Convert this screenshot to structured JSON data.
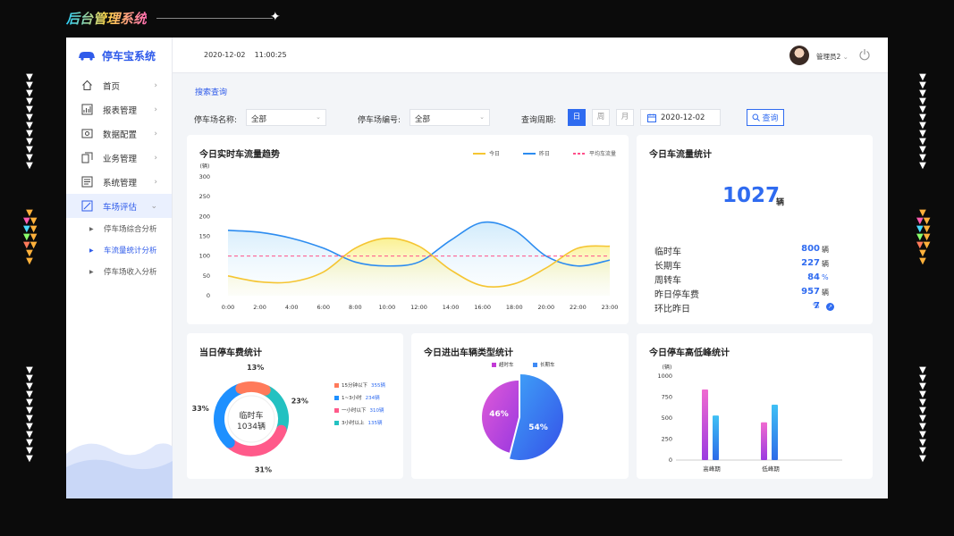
{
  "outer_title": "后台管理系统",
  "brand": "停车宝系统",
  "header": {
    "date": "2020-12-02",
    "time": "11:00:25",
    "user": "管理员2"
  },
  "nav": {
    "items": [
      {
        "label": "首页",
        "icon": "home-icon"
      },
      {
        "label": "报表管理",
        "icon": "report-icon"
      },
      {
        "label": "数据配置",
        "icon": "config-icon"
      },
      {
        "label": "业务管理",
        "icon": "business-icon"
      },
      {
        "label": "系统管理",
        "icon": "system-icon"
      },
      {
        "label": "车场评估",
        "icon": "evaluate-icon"
      }
    ],
    "sub_items": [
      "停车场综合分析",
      "车流量统计分析",
      "停车场收入分析"
    ]
  },
  "filters": {
    "section": "搜索查询",
    "name_label": "停车场名称:",
    "name_value": "全部",
    "code_label": "停车场编号:",
    "code_value": "全部",
    "period_label": "查询周期:",
    "periods": [
      "日",
      "周",
      "月"
    ],
    "date": "2020-12-02",
    "query_button": "查询"
  },
  "trend": {
    "title": "今日实时车流量趋势",
    "unit": "(辆)",
    "legend": [
      "今日",
      "昨日",
      "平均车流量"
    ],
    "colors": {
      "today": "#f5c532",
      "yesterday": "#2c8cf0",
      "average": "#ff4f8a"
    }
  },
  "stats": {
    "title": "今日车流量统计",
    "total": "1027",
    "total_unit": "辆",
    "rows": [
      {
        "label": "临时车",
        "value": "800",
        "unit": "辆"
      },
      {
        "label": "长期车",
        "value": "227",
        "unit": "辆"
      },
      {
        "label": "周转车",
        "value": "84",
        "unit": "%"
      },
      {
        "label": "昨日停车费",
        "value": "957",
        "unit": "辆"
      },
      {
        "label": "环比昨日",
        "value": "7",
        "unit": "%"
      }
    ]
  },
  "fee": {
    "title": "当日停车费统计",
    "center_label": "临时车",
    "center_value": "1034辆",
    "segments": [
      {
        "label": "15分钟以下",
        "value": "355辆",
        "pct": "23%",
        "color": "#23c1c1"
      },
      {
        "label": "1~3小时",
        "value": "234辆",
        "pct": "31%",
        "color": "#ff5a8a"
      },
      {
        "label": "一小时以下",
        "value": "310辆",
        "pct": "33%",
        "color": "#1e90ff"
      },
      {
        "label": "3小时以上",
        "value": "135辆",
        "pct": "13%",
        "color": "#ff7a5a"
      }
    ]
  },
  "types": {
    "title": "今日进出车辆类型统计",
    "legend": [
      "超时车",
      "长期车"
    ],
    "pcts": [
      "46%",
      "54%"
    ]
  },
  "peak": {
    "title": "今日停车高低峰统计",
    "unit": "(辆)",
    "categories": [
      "高峰期",
      "低峰期"
    ]
  },
  "chart_data": [
    {
      "type": "line",
      "title": "今日实时车流量趋势",
      "ylabel": "(辆)",
      "x": [
        "0:00",
        "2:00",
        "4:00",
        "6:00",
        "8:00",
        "10:00",
        "12:00",
        "14:00",
        "16:00",
        "18:00",
        "20:00",
        "22:00",
        "23:00"
      ],
      "ylim": [
        0,
        300
      ],
      "yticks": [
        0,
        50,
        100,
        150,
        200,
        250,
        300
      ],
      "series": [
        {
          "name": "今日",
          "values": [
            50,
            35,
            35,
            60,
            120,
            145,
            125,
            65,
            25,
            30,
            70,
            120,
            125
          ]
        },
        {
          "name": "昨日",
          "values": [
            165,
            160,
            145,
            120,
            85,
            75,
            85,
            140,
            185,
            165,
            100,
            75,
            90
          ]
        },
        {
          "name": "平均车流量",
          "values": [
            100,
            100,
            100,
            100,
            100,
            100,
            100,
            100,
            100,
            100,
            100,
            100,
            100
          ]
        }
      ]
    },
    {
      "type": "pie",
      "title": "当日停车费统计",
      "categories": [
        "15分钟以下",
        "1~3小时",
        "一小时以下",
        "3小时以上"
      ],
      "values": [
        23,
        31,
        33,
        13
      ]
    },
    {
      "type": "pie",
      "title": "今日进出车辆类型统计",
      "categories": [
        "超时车",
        "长期车"
      ],
      "values": [
        46,
        54
      ]
    },
    {
      "type": "bar",
      "title": "今日停车高低峰统计",
      "ylabel": "(辆)",
      "categories": [
        "高峰期",
        "低峰期"
      ],
      "ylim": [
        0,
        1000
      ],
      "yticks": [
        0,
        250,
        500,
        750,
        1000
      ],
      "series": [
        {
          "values": [
            840,
            450
          ]
        },
        {
          "values": [
            530,
            660
          ]
        }
      ]
    }
  ]
}
